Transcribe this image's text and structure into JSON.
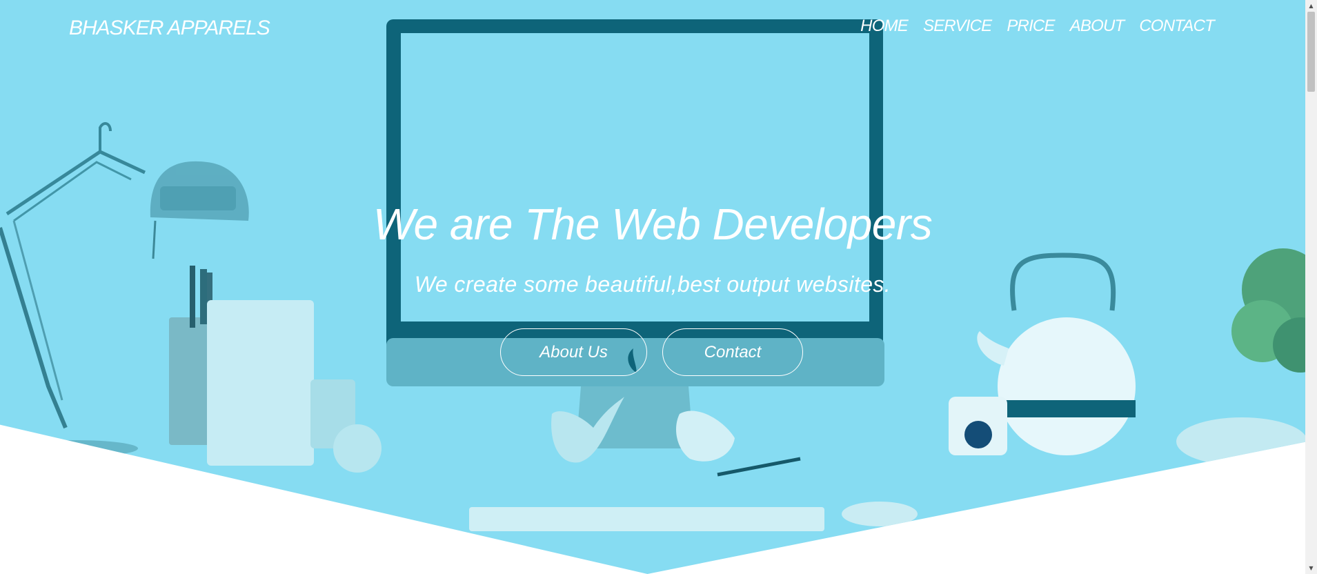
{
  "header": {
    "brand": "BHASKER APPARELS",
    "nav": [
      "HOME",
      "SERVICE",
      "PRICE",
      "ABOUT",
      "CONTACT"
    ]
  },
  "hero": {
    "title": "We are The Web Developers",
    "subtitle": "We create some beautiful,best output websites.",
    "buttons": {
      "about": "About Us",
      "contact": "Contact"
    }
  },
  "colors": {
    "hero_overlay": "#86dcf2",
    "text": "#ffffff",
    "background": "#ffffff"
  },
  "icons": {
    "scroll_up": "triangle-up",
    "scroll_down": "triangle-down",
    "monitor_logo": "apple-logo-icon"
  }
}
